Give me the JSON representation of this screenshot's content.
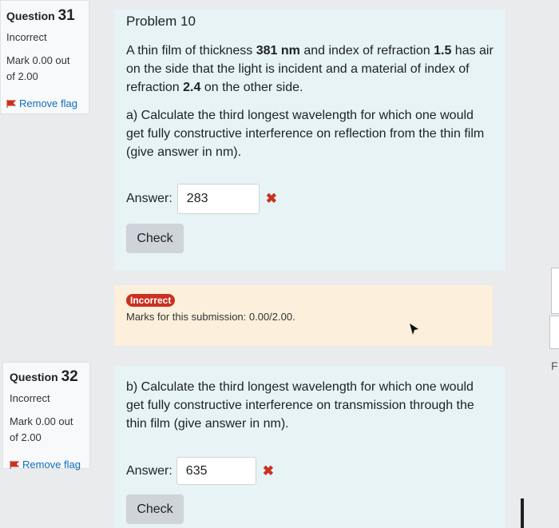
{
  "q31": {
    "label": "Question",
    "number": "31",
    "state": "Incorrect",
    "grade_line1": "Mark 0.00 out",
    "grade_line2": "of 2.00",
    "flag_label": "Remove flag"
  },
  "q32": {
    "label": "Question",
    "number": "32",
    "state": "Incorrect",
    "grade_line1": "Mark 0.00 out",
    "grade_line2": "of 2.00",
    "flag_label": "Remove flag"
  },
  "problem": {
    "title": "Problem 10",
    "intro_1": "A thin film of thickness ",
    "thickness": "381 nm",
    "intro_2": " and index of refraction ",
    "index_film": "1.5",
    "intro_3": " has air on the side that the light is incident and a material of index of refraction ",
    "index_sub": "2.4",
    "intro_4": " on the other side.",
    "part_a": "a) Calculate the third longest wavelength for which one would get fully constructive interference on reflection from the thin film (give answer in nm).",
    "part_b": "b) Calculate the third longest wavelength for which one would get fully constructive interference on transmission through the thin film (give answer in nm)."
  },
  "answer_a": {
    "label": "Answer:",
    "value": "283",
    "check": "Check",
    "mark": "✖"
  },
  "answer_b": {
    "label": "Answer:",
    "value": "635",
    "check": "Check",
    "mark": "✖"
  },
  "feedback": {
    "badge": "Incorrect",
    "marks": "Marks for this submission: 0.00/2.00."
  },
  "edge_letter": "F",
  "colors": {
    "incorrect": "#ca3120",
    "link": "#0f6cbf",
    "formulation_bg": "#e7f3f5",
    "outcome_bg": "#fcefdc"
  }
}
